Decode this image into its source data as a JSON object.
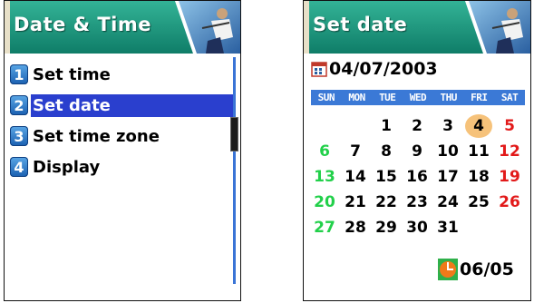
{
  "left": {
    "title": "Date & Time",
    "menu": [
      {
        "num": "1",
        "label": "Set time"
      },
      {
        "num": "2",
        "label": "Set date"
      },
      {
        "num": "3",
        "label": "Set time zone"
      },
      {
        "num": "4",
        "label": "Display"
      }
    ],
    "selected_index": 1
  },
  "right": {
    "title": "Set date",
    "date": "04/07/2003",
    "weekdays": [
      "SUN",
      "MON",
      "TUE",
      "WED",
      "THU",
      "FRI",
      "SAT"
    ],
    "weeks": [
      [
        "",
        "",
        "",
        "1",
        "2",
        "3",
        "4",
        "5"
      ],
      [
        "6",
        "7",
        "8",
        "9",
        "10",
        "11",
        "12"
      ],
      [
        "13",
        "14",
        "15",
        "16",
        "17",
        "18",
        "19"
      ],
      [
        "20",
        "21",
        "22",
        "23",
        "24",
        "25",
        "26"
      ],
      [
        "27",
        "28",
        "29",
        "30",
        "31",
        "",
        ""
      ]
    ],
    "today": "4",
    "footer_date": "06/05"
  },
  "colors": {
    "title_teal": "#1c9a82",
    "highlight": "#2a3fce",
    "weekday_bar": "#3b79d6",
    "sunday": "#22d04a",
    "saturday": "#e21a1a",
    "today_circle": "#f6c27a"
  },
  "icons": {
    "title_image": "golfer-photo",
    "number_badges": "number-badge-icon",
    "calendar": "calendar-icon",
    "footer": "clock-flag-icon"
  }
}
